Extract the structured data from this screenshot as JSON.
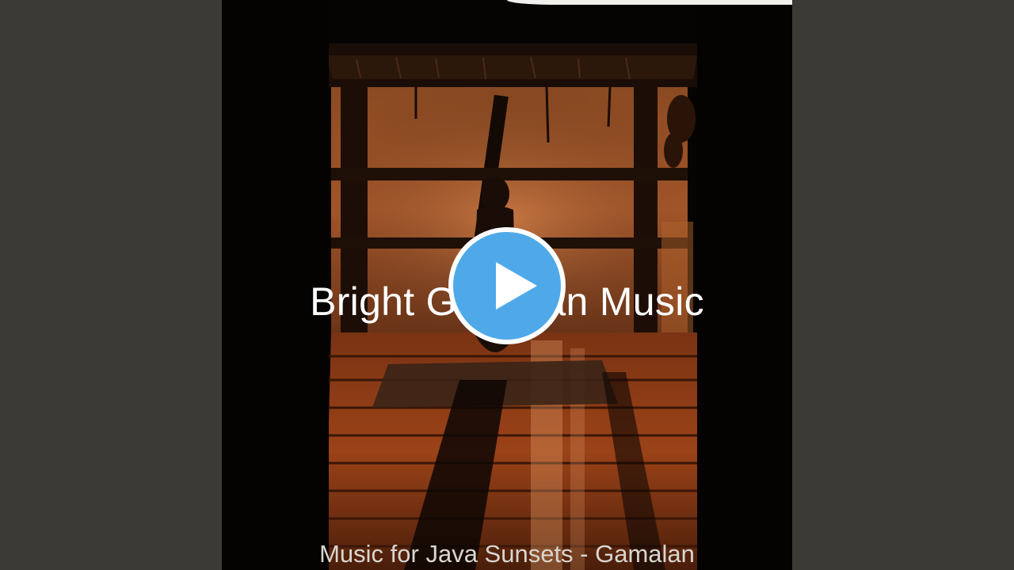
{
  "video": {
    "title_overlay": "Bright Gamalan Music",
    "subtitle_overlay": "Music for Java Sunsets - Gamalan",
    "play_button_label": "Play",
    "play_icon": "play-icon",
    "thumbnail_alt": "album-art-veranda-sunset"
  },
  "colors": {
    "page_background": "#3b3a35",
    "play_button_fill": "#4fa9e9",
    "play_button_ring": "#ffffff",
    "title_color": "#ffffff",
    "subtitle_color": "#d9d6d0"
  }
}
